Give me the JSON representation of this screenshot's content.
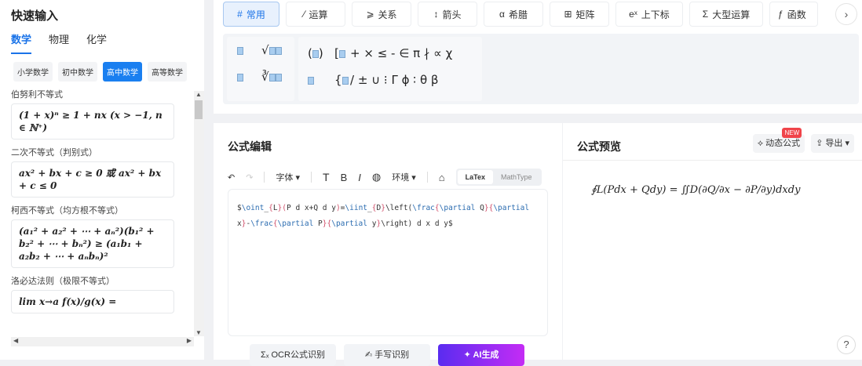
{
  "left": {
    "title": "快速输入",
    "subjects": [
      "数学",
      "物理",
      "化学"
    ],
    "levels": [
      "小学数学",
      "初中数学",
      "高中数学",
      "高等数学"
    ],
    "items": [
      {
        "title": "伯努利不等式",
        "formula": "(1 + x)ⁿ ≥ 1 + nx   (x > −1, n ∈ ℕ⁺)"
      },
      {
        "title": "二次不等式（判别式）",
        "formula": "ax² + bx + c ≥ 0 或 ax² + bx + c ≤ 0"
      },
      {
        "title": "柯西不等式（均方根不等式）",
        "formula": "(a₁² + a₂² + ⋯ + aₙ²)(b₁² + b₂² + ⋯ + bₙ²) ≥ (a₁b₁ + a₂b₂ + ⋯ + aₙbₙ)²"
      },
      {
        "title": "洛必达法则（极限不等式）",
        "formula": "lim x→a f(x)/g(x) ="
      }
    ]
  },
  "tabs": [
    {
      "icon": "#",
      "label": "常用"
    },
    {
      "icon": "⁄",
      "label": "运算"
    },
    {
      "icon": "⩾",
      "label": "关系"
    },
    {
      "icon": "↕",
      "label": "箭头"
    },
    {
      "icon": "α",
      "label": "希腊"
    },
    {
      "icon": "⊞",
      "label": "矩阵"
    },
    {
      "icon": "eˣ",
      "label": "上下标"
    },
    {
      "icon": "Σ",
      "label": "大型运算"
    },
    {
      "icon": "ƒ",
      "label": "函数"
    }
  ],
  "palette": {
    "row1": [
      "+",
      "×",
      "≤",
      "-",
      "∈",
      "π",
      "∤",
      "∝",
      "χ"
    ],
    "row2": [
      "/",
      "±",
      "∪",
      "⁝",
      "Γ",
      "ϕ",
      "∶",
      "θ",
      "β"
    ]
  },
  "editor": {
    "title": "公式编辑",
    "font": "字体",
    "env": "环境",
    "modes": [
      "LaTex",
      "MathType"
    ],
    "code": [
      [
        "t",
        "$"
      ],
      [
        "c",
        "\\oint"
      ],
      [
        "t",
        "_"
      ],
      [
        "b",
        "{"
      ],
      [
        "t",
        "L"
      ],
      [
        "b",
        "}"
      ],
      [
        "b",
        "("
      ],
      [
        "t",
        "P d x+Q d y"
      ],
      [
        "b",
        ")"
      ],
      [
        "t",
        "="
      ],
      [
        "c",
        "\\iint"
      ],
      [
        "t",
        "_"
      ],
      [
        "b",
        "{"
      ],
      [
        "t",
        "D"
      ],
      [
        "b",
        "}"
      ],
      [
        "t",
        "\\left("
      ],
      [
        "c",
        "\\frac"
      ],
      [
        "b",
        "{"
      ],
      [
        "c",
        "\\partial"
      ],
      [
        "t",
        " Q"
      ],
      [
        "b",
        "}"
      ],
      [
        "b",
        "{"
      ],
      [
        "c",
        "\\partial"
      ],
      [
        "t",
        " x"
      ],
      [
        "b",
        "}"
      ],
      [
        "t",
        "-"
      ],
      [
        "c",
        "\\frac"
      ],
      [
        "b",
        "{"
      ],
      [
        "c",
        "\\partial"
      ],
      [
        "t",
        " P"
      ],
      [
        "b",
        "}"
      ],
      [
        "b",
        "{"
      ],
      [
        "c",
        "\\partial"
      ],
      [
        "t",
        " y"
      ],
      [
        "b",
        "}"
      ],
      [
        "t",
        "\\right) d x d y$"
      ]
    ],
    "buttons": [
      "OCR公式识别",
      "手写识别",
      "AI生成"
    ]
  },
  "preview": {
    "title": "公式预览",
    "dynamic": "动态公式",
    "new_badge": "NEW",
    "export": "导出",
    "formula": "∮L(Pdx + Qdy) = ∬D(∂Q/∂x − ∂P/∂y)dxdy"
  },
  "help": "?"
}
